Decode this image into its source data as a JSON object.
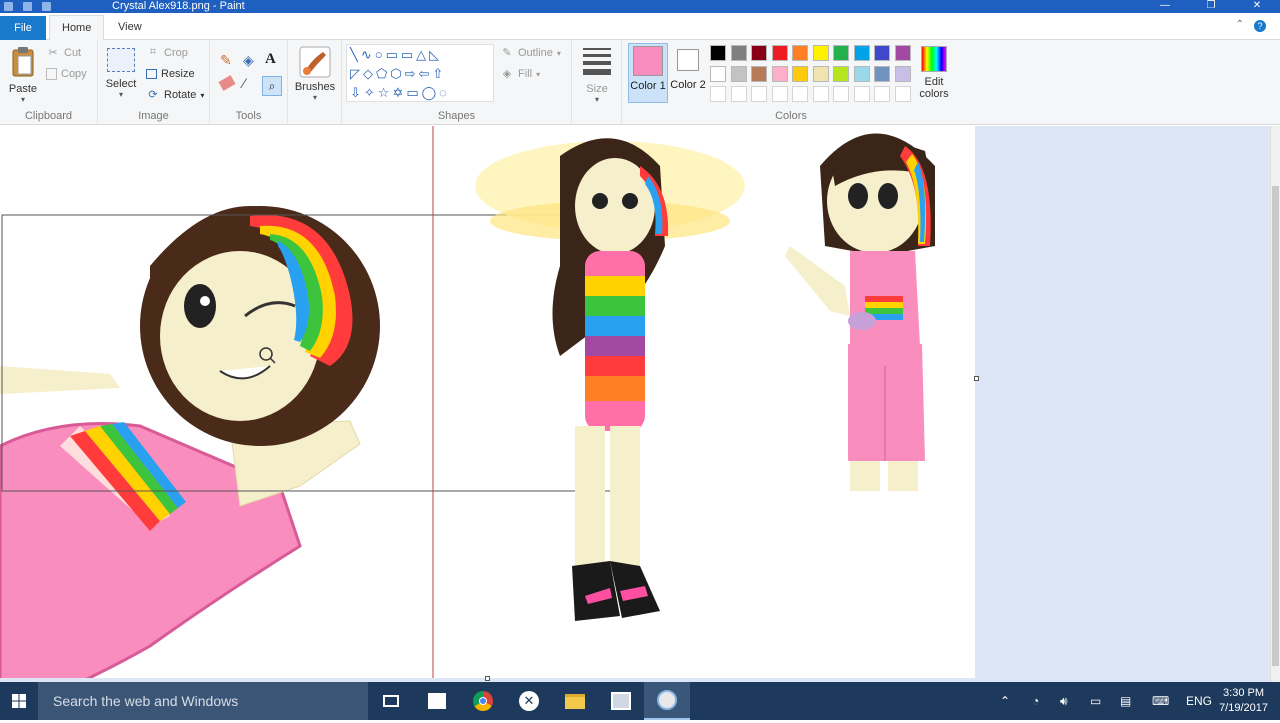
{
  "window": {
    "title": "Crystal Alex918.png - Paint"
  },
  "tabs": {
    "file": "File",
    "home": "Home",
    "view": "View"
  },
  "clipboard": {
    "paste": "Paste",
    "cut": "Cut",
    "copy": "Copy",
    "group": "Clipboard"
  },
  "image": {
    "select": "Select",
    "crop": "Crop",
    "resize": "Resize",
    "rotate": "Rotate",
    "group": "Image"
  },
  "tools": {
    "group": "Tools"
  },
  "brushes": {
    "label": "Brushes"
  },
  "shapes": {
    "outline": "Outline",
    "fill": "Fill",
    "group": "Shapes"
  },
  "size": {
    "label": "Size"
  },
  "colors": {
    "color1": "Color 1",
    "color2": "Color 2",
    "edit": "Edit colors",
    "group": "Colors",
    "color1_value": "#f98dbd",
    "color2_value": "#ffffff",
    "palette_row1": [
      "#000000",
      "#7f7f7f",
      "#880015",
      "#ed1c24",
      "#ff7f27",
      "#fff200",
      "#22b14c",
      "#00a2e8",
      "#3f48cc",
      "#a349a4"
    ],
    "palette_row2": [
      "#ffffff",
      "#c3c3c3",
      "#b97a57",
      "#ffaec9",
      "#ffc90e",
      "#efe4b0",
      "#b5e61d",
      "#99d9ea",
      "#7092be",
      "#c8bfe7"
    ]
  },
  "taskbar": {
    "search_placeholder": "Search the web and Windows",
    "lang": "ENG",
    "time": "3:30 PM",
    "date": "7/19/2017"
  }
}
